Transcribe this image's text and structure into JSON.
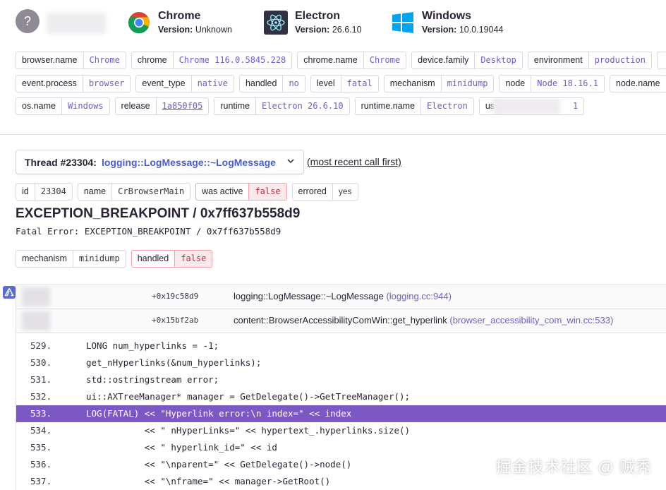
{
  "contexts": {
    "user": {
      "avatar_text": "?"
    },
    "browser": {
      "name": "Chrome",
      "version_label": "Version:",
      "version": "Unknown"
    },
    "runtime": {
      "name": "Electron",
      "version_label": "Version:",
      "version": "26.6.10"
    },
    "os": {
      "name": "Windows",
      "version_label": "Version:",
      "version": "10.0.19044"
    }
  },
  "tags": {
    "row1": [
      {
        "key": "browser.name",
        "value": "Chrome"
      },
      {
        "key": "chrome",
        "value": "Chrome 116.0.5845.228"
      },
      {
        "key": "chrome.name",
        "value": "Chrome"
      },
      {
        "key": "device.family",
        "value": "Desktop"
      },
      {
        "key": "environment",
        "value": "production"
      }
    ],
    "row2": [
      {
        "key": "event.process",
        "value": "browser"
      },
      {
        "key": "event_type",
        "value": "native"
      },
      {
        "key": "handled",
        "value": "no"
      },
      {
        "key": "level",
        "value": "fatal"
      },
      {
        "key": "mechanism",
        "value": "minidump"
      },
      {
        "key": "node",
        "value": "Node 18.16.1"
      },
      {
        "key": "node.name",
        "value": ""
      }
    ],
    "row3": [
      {
        "key": "os.name",
        "value": "Windows"
      },
      {
        "key": "release",
        "value": "1a850f05"
      },
      {
        "key": "runtime",
        "value": "Electron 26.6.10"
      },
      {
        "key": "runtime.name",
        "value": "Electron"
      },
      {
        "key": "us",
        "value": "1"
      }
    ]
  },
  "thread": {
    "label": "Thread #23304:",
    "function": "logging::LogMessage::~LogMessage",
    "order_note": "(most recent call first)",
    "meta": [
      {
        "key": "id",
        "value": "23304",
        "danger": false
      },
      {
        "key": "name",
        "value": "CrBrowserMain",
        "danger": false
      },
      {
        "key": "was active",
        "value": "false",
        "danger": true
      },
      {
        "key": "errored",
        "value": "yes",
        "danger": false
      }
    ]
  },
  "exception": {
    "title": "EXCEPTION_BREAKPOINT / 0x7ff637b558d9",
    "subtitle": "Fatal Error: EXCEPTION_BREAKPOINT / 0x7ff637b558d9",
    "mechanism": [
      {
        "key": "mechanism",
        "value": "minidump",
        "danger": false
      },
      {
        "key": "handled",
        "value": "false",
        "danger": true
      }
    ]
  },
  "frames": [
    {
      "address": "+0x19c58d9",
      "function": "logging::LogMessage::~LogMessage",
      "file": "(logging.cc:944)"
    },
    {
      "address": "+0x15bf2ab",
      "function": "content::BrowserAccessibilityComWin::get_hyperlink",
      "file": "(browser_accessibility_com_win.cc:533)"
    }
  ],
  "code_lines": [
    {
      "num": "529.",
      "src": "LONG num_hyperlinks = -1;",
      "active": false
    },
    {
      "num": "530.",
      "src": "get_nHyperlinks(&num_hyperlinks);",
      "active": false
    },
    {
      "num": "531.",
      "src": "std::ostringstream error;",
      "active": false
    },
    {
      "num": "532.",
      "src": "ui::AXTreeManager* manager = GetDelegate()->GetTreeManager();",
      "active": false
    },
    {
      "num": "533.",
      "src": "LOG(FATAL) << \"Hyperlink error:\\n index=\" << index",
      "active": true
    },
    {
      "num": "534.",
      "src": "           << \" nHyperLinks=\" << hypertext_.hyperlinks.size()",
      "active": false
    },
    {
      "num": "535.",
      "src": "           << \" hyperlink_id=\" << id",
      "active": false
    },
    {
      "num": "536.",
      "src": "           << \"\\nparent=\" << GetDelegate()->node()",
      "active": false
    },
    {
      "num": "537.",
      "src": "           << \"\\nframe=\" << manager->GetRoot()",
      "active": false
    }
  ],
  "watermark": "掘金技术社区 @ 贼秃"
}
